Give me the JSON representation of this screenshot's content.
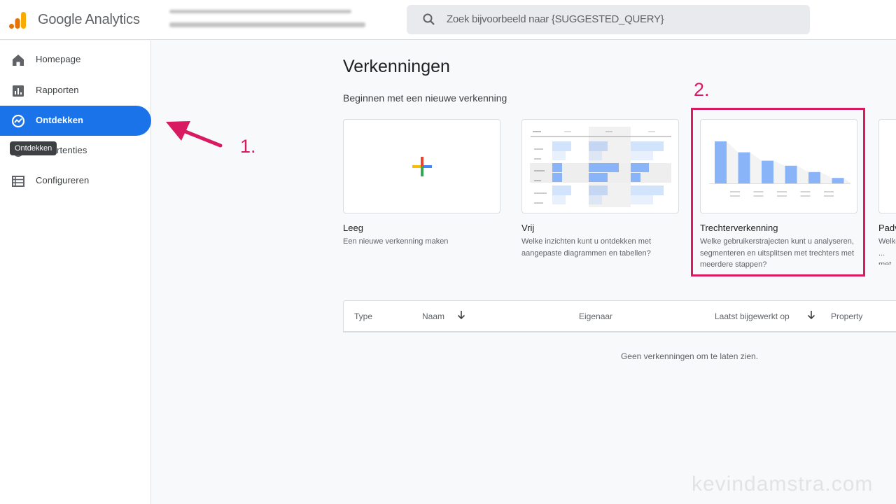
{
  "header": {
    "app_title": "Google Analytics",
    "search": {
      "placeholder": "Zoek bijvoorbeeld naar {SUGGESTED_QUERY}"
    }
  },
  "sidebar": {
    "items": [
      {
        "label": "Homepage",
        "icon": "home-icon",
        "active": false
      },
      {
        "label": "Rapporten",
        "icon": "bar-chart-icon",
        "active": false
      },
      {
        "label": "Ontdekken",
        "icon": "explore-icon",
        "active": true
      },
      {
        "label": "Advertenties",
        "icon": "advertising-icon",
        "active": false
      },
      {
        "label": "Configureren",
        "icon": "list-icon",
        "active": false
      }
    ],
    "tooltip": "Ontdekken"
  },
  "main": {
    "title": "Verkenningen",
    "subtitle": "Beginnen met een nieuwe verkenning",
    "cards": [
      {
        "title": "Leeg",
        "description": "Een nieuwe verkenning maken"
      },
      {
        "title": "Vrij",
        "description": "Welke inzichten kunt u ontdekken met aangepaste diagrammen en tabellen?"
      },
      {
        "title": "Trechterverkenning",
        "description": "Welke gebruikerstrajecten kunt u analyseren, segmenteren en uitsplitsen met trechters met meerdere stappen?"
      },
      {
        "title": "Padverkenning",
        "description": "Welke ... met s..."
      }
    ],
    "funnel_preview_steps": [
      1.0,
      0.74,
      0.54,
      0.42,
      0.27,
      0.13
    ],
    "table": {
      "columns": [
        {
          "label": "Type",
          "sortable": false
        },
        {
          "label": "Naam",
          "sortable": true
        },
        {
          "label": "Eigenaar",
          "sortable": false
        },
        {
          "label": "Laatst bijgewerkt op",
          "sortable": true
        },
        {
          "label": "Property",
          "sortable": false
        }
      ],
      "empty_message": "Geen verkenningen om te laten zien."
    }
  },
  "annotations": {
    "step1": "1.",
    "step2": "2.",
    "color": "#d81b60"
  },
  "watermark": "kevindamstra.com",
  "colors": {
    "accent": "#1a73e8",
    "highlight": "#d81b60"
  }
}
